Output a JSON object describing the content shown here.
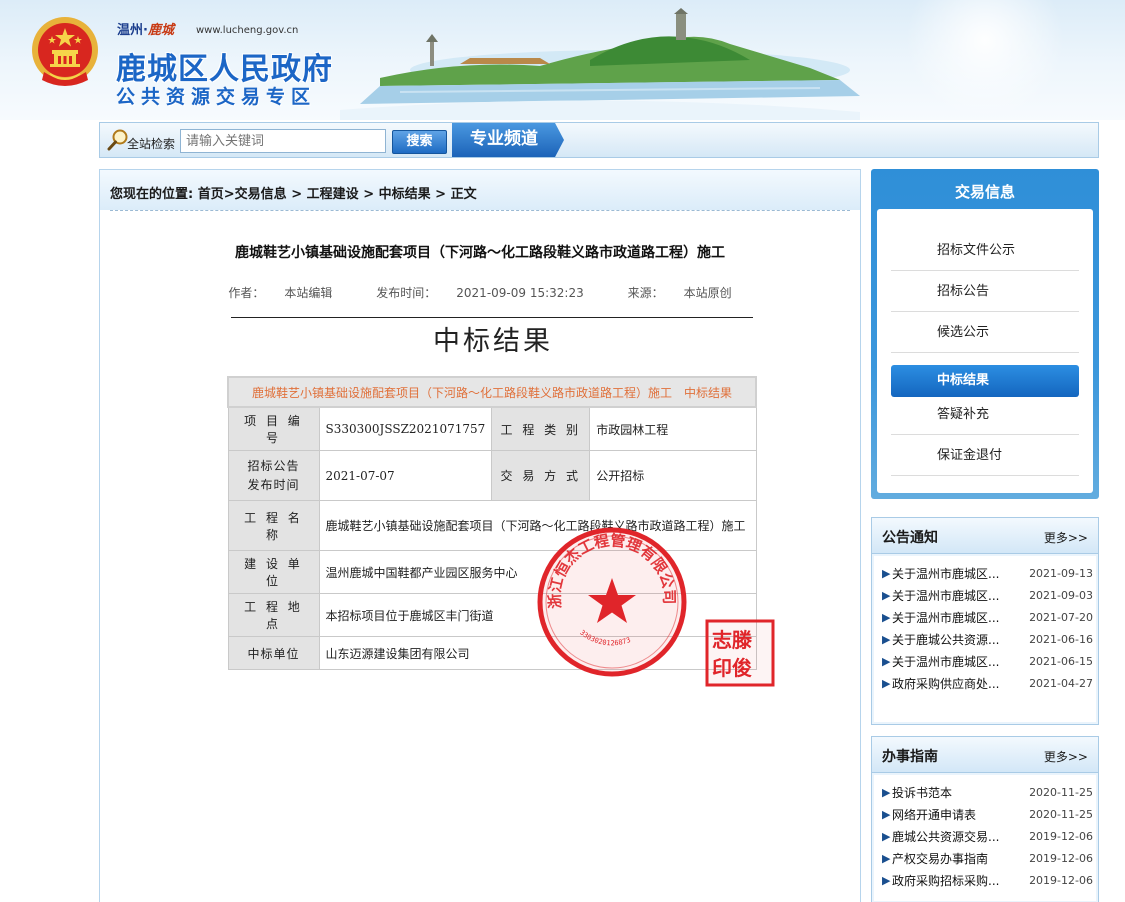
{
  "header": {
    "city_prefix": "温州·",
    "city_calligraphy": "鹿城",
    "url": "www.lucheng.gov.cn",
    "title": "鹿城区人民政府",
    "subtitle": "公共资源交易专区"
  },
  "search": {
    "label": "全站检索",
    "placeholder": "请输入关键词",
    "button_label": "搜索",
    "channel_label": "专业频道"
  },
  "breadcrumb": {
    "prefix": "您现在的位置:",
    "items": [
      "首页",
      "交易信息",
      "工程建设",
      "中标结果",
      "正文"
    ]
  },
  "article": {
    "title": "鹿城鞋艺小镇基础设施配套项目（下河路～化工路段鞋义路市政道路工程）施工",
    "author_label": "作者：",
    "author": "本站编辑",
    "time_label": "发布时间：",
    "time": "2021-09-09 15:32:23",
    "source_label": "来源：",
    "source": "本站原创"
  },
  "document": {
    "heading": "中标结果",
    "caption": "鹿城鞋艺小镇基础设施配套项目（下河路～化工路段鞋义路市政道路工程）施工　中标结果",
    "rows": {
      "project_no_label": "项 目 编 号",
      "project_no": "S330300JSSZ2021071757",
      "project_type_label": "工 程 类 别",
      "project_type": "市政园林工程",
      "notice_time_label_1": "招标公告",
      "notice_time_label_2": "发布时间",
      "notice_time": "2021-07-07",
      "trade_method_label": "交 易 方 式",
      "trade_method": "公开招标",
      "project_name_label": "工 程 名 称",
      "project_name": "鹿城鞋艺小镇基础设施配套项目（下河路～化工路段鞋义路市政道路工程）施工",
      "builder_label": "建 设 单 位",
      "builder": "温州鹿城中国鞋都产业园区服务中心",
      "location_label": "工 程 地 点",
      "location": "本招标项目位于鹿城区丰门街道",
      "winner_label": "中标单位",
      "winner": "山东迈源建设集团有限公司"
    },
    "seal_text": "浙江恒杰工程管理有限公司",
    "seal_number": "3303020126873",
    "signature_stamp": "志滕印俊"
  },
  "sidebar": {
    "nav_title": "交易信息",
    "nav_items": [
      "招标文件公示",
      "招标公告",
      "候选公示",
      "中标结果",
      "答疑补充",
      "保证金退付"
    ],
    "active_index": 3,
    "notice_box": {
      "title": "公告通知",
      "more": "更多>>",
      "items": [
        {
          "text": "关于温州市鹿城区...",
          "date": "2021-09-13"
        },
        {
          "text": "关于温州市鹿城区...",
          "date": "2021-09-03"
        },
        {
          "text": "关于温州市鹿城区...",
          "date": "2021-07-20"
        },
        {
          "text": "关于鹿城公共资源...",
          "date": "2021-06-16"
        },
        {
          "text": "关于温州市鹿城区...",
          "date": "2021-06-15"
        },
        {
          "text": "政府采购供应商处...",
          "date": "2021-04-27"
        }
      ]
    },
    "guide_box": {
      "title": "办事指南",
      "more": "更多>>",
      "items": [
        {
          "text": "投诉书范本",
          "date": "2020-11-25"
        },
        {
          "text": "网络开通申请表",
          "date": "2020-11-25"
        },
        {
          "text": "鹿城公共资源交易...",
          "date": "2019-12-06"
        },
        {
          "text": "产权交易办事指南",
          "date": "2019-12-06"
        },
        {
          "text": "政府采购招标采购...",
          "date": "2019-12-06"
        }
      ]
    }
  },
  "colors": {
    "brand_blue": "#1c66c6",
    "nav_blue": "#2f8fd8",
    "seal_red": "#e0252a",
    "caption_orange": "#e0703a"
  }
}
